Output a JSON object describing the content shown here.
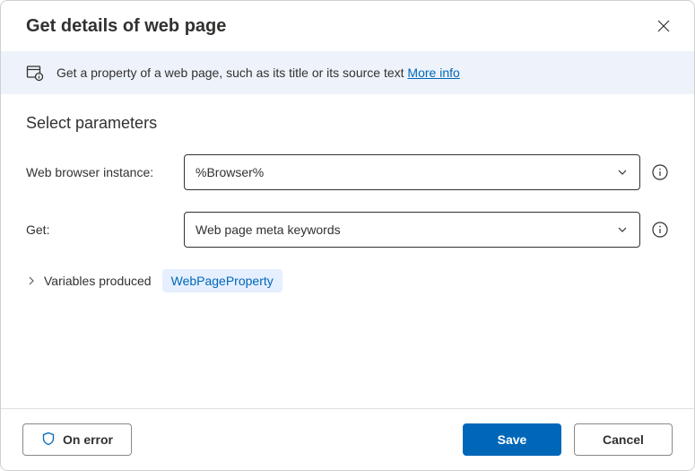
{
  "dialog": {
    "title": "Get details of web page",
    "close_aria": "Close"
  },
  "infobar": {
    "text": "Get a property of a web page, such as its title or its source text ",
    "more_info": "More info"
  },
  "body": {
    "section_title": "Select parameters",
    "fields": {
      "browser": {
        "label": "Web browser instance:",
        "value": "%Browser%"
      },
      "get": {
        "label": "Get:",
        "value": "Web page meta keywords"
      }
    },
    "variables": {
      "label": "Variables produced",
      "chip": "WebPageProperty"
    }
  },
  "footer": {
    "on_error": "On error",
    "save": "Save",
    "cancel": "Cancel"
  }
}
